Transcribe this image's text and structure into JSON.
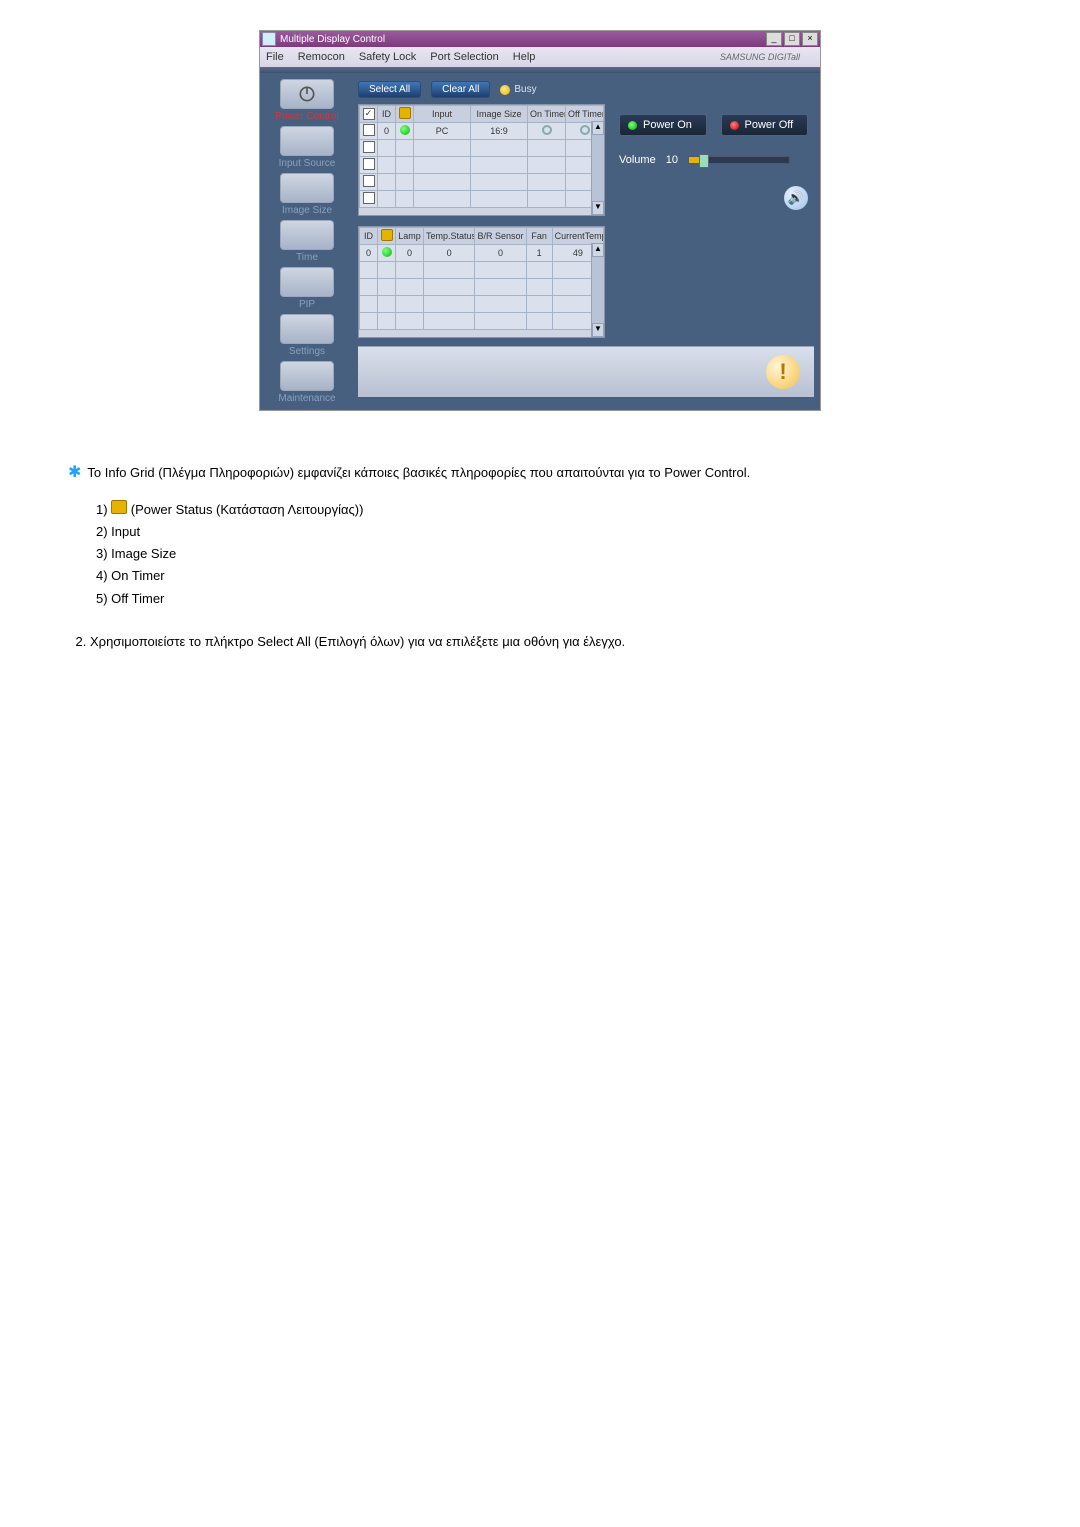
{
  "window": {
    "title": "Multiple Display Control"
  },
  "menu": [
    "File",
    "Remocon",
    "Safety Lock",
    "Port Selection",
    "Help"
  ],
  "brand": "SAMSUNG DIGITall",
  "sidebar": [
    {
      "label": "Power Control",
      "active": true
    },
    {
      "label": "Input Source"
    },
    {
      "label": "Image Size"
    },
    {
      "label": "Time"
    },
    {
      "label": "PIP"
    },
    {
      "label": "Settings"
    },
    {
      "label": "Maintenance"
    }
  ],
  "buttons": {
    "selectAll": "Select All",
    "clearAll": "Clear All",
    "busy": "Busy"
  },
  "grid1": {
    "headers": [
      "",
      "ID",
      "",
      "Input",
      "Image Size",
      "On Timer",
      "Off Timer"
    ],
    "row": {
      "id": "0",
      "input": "PC",
      "imageSize": "16:9"
    }
  },
  "grid2": {
    "headers": [
      "ID",
      "",
      "Lamp",
      "Temp.Status",
      "B/R Sensor",
      "Fan",
      "CurrentTemp."
    ],
    "row": {
      "id": "0",
      "lamp": "0",
      "temp": "0",
      "sensor": "0",
      "fan": "1",
      "cur": "49"
    }
  },
  "callouts": [
    "1",
    "2",
    "3",
    "4",
    "5"
  ],
  "power": {
    "on": "Power On",
    "off": "Power Off"
  },
  "volume": {
    "label": "Volume",
    "value": "10"
  },
  "notes": {
    "intro": "Το Info Grid (Πλέγμα Πληροφοριών) εμφανίζει κάποιες βασικές πληροφορίες που απαιτούνται για το Power Control.",
    "items": [
      "(Power Status (Κατάσταση Λειτουργίας))",
      "Input",
      "Image Size",
      "On Timer",
      "Off Timer"
    ],
    "step2": "Χρησιμοποιείστε το πλήκτρο Select All (Επιλογή όλων) για να επιλέξετε μια οθόνη για έλεγχο."
  }
}
